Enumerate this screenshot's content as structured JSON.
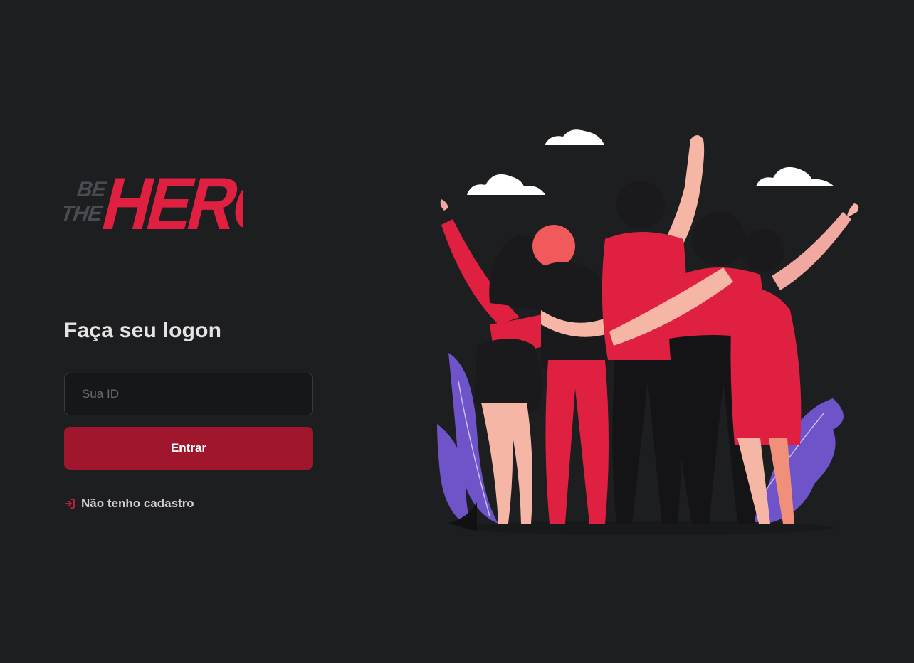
{
  "brand": {
    "logo_small": "BE THE",
    "logo_large": "HERO",
    "colors": {
      "accent": "#e02041",
      "muted": "#4a4b52"
    }
  },
  "login": {
    "title": "Faça seu logon",
    "id_placeholder": "Sua ID",
    "submit_label": "Entrar",
    "register_link": "Não tenho cadastro",
    "register_icon": "log-in-icon"
  },
  "colors": {
    "background": "#1d1e20",
    "button": "#a0172d",
    "input_bg": "#161719",
    "text": "#e4e2e3"
  },
  "illustration": {
    "subject": "heroes-group-illustration"
  }
}
